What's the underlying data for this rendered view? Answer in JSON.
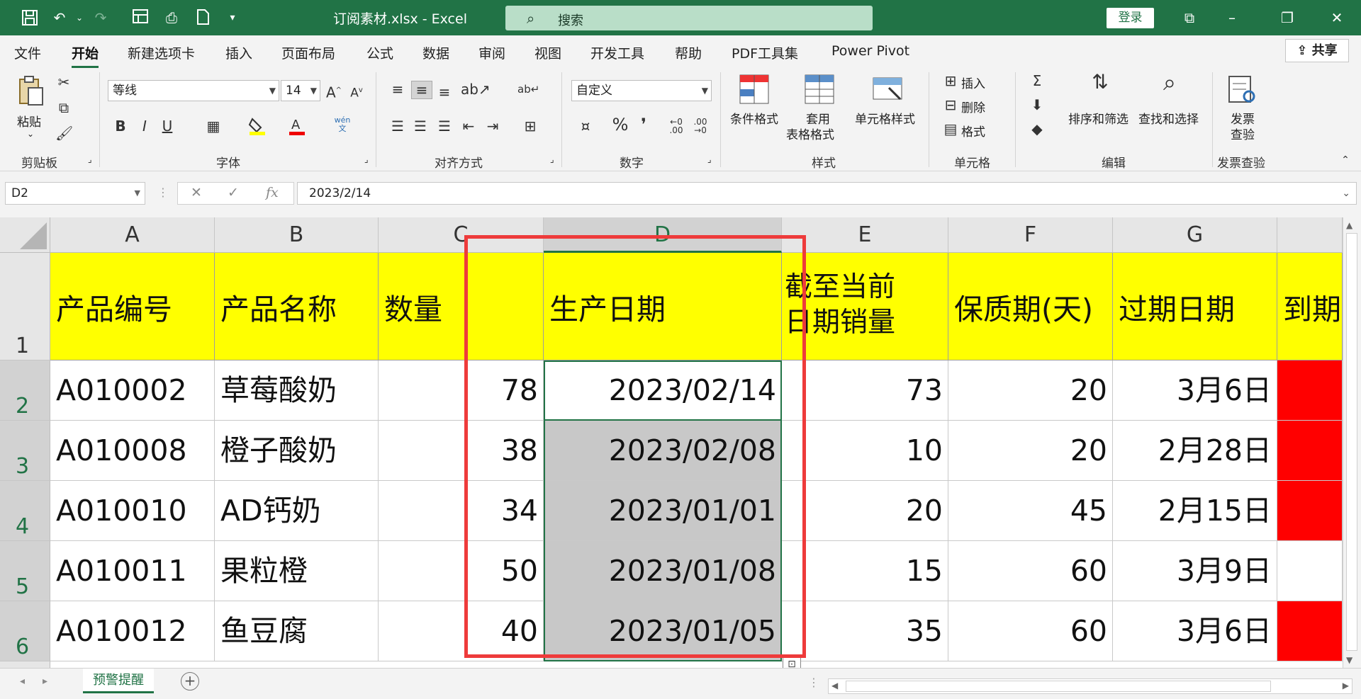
{
  "titlebar": {
    "doc_title": "订阅素材.xlsx  -  Excel",
    "search_placeholder": "搜索",
    "login": "登录",
    "icons": [
      "save-icon",
      "undo-icon",
      "redo-icon",
      "form-icon",
      "print-preview-icon",
      "file-icon",
      "customize-icon"
    ]
  },
  "tabs": [
    "文件",
    "开始",
    "新建选项卡",
    "插入",
    "页面布局",
    "公式",
    "数据",
    "审阅",
    "视图",
    "开发工具",
    "帮助",
    "PDF工具集",
    "Power Pivot"
  ],
  "active_tab": "开始",
  "share": "共享",
  "ribbon": {
    "clipboard": {
      "paste": "粘贴",
      "label": "剪贴板"
    },
    "font": {
      "name": "等线",
      "size": "14",
      "label": "字体",
      "bold": "B",
      "italic": "I",
      "underline": "U",
      "wen": "wén"
    },
    "alignment": {
      "label": "对齐方式"
    },
    "number": {
      "format": "自定义",
      "label": "数字",
      "percent": "%",
      "comma": "❜"
    },
    "styles": {
      "conditional": "条件格式",
      "table_line1": "套用",
      "table_line2": "表格格式",
      "cell_styles": "单元格样式",
      "label": "样式"
    },
    "cells": {
      "insert": "插入",
      "delete": "删除",
      "format": "格式",
      "label": "单元格"
    },
    "editing": {
      "sort_filter": "排序和筛选",
      "find_select": "查找和选择",
      "label": "编辑"
    },
    "invoice": {
      "line1": "发票",
      "line2": "查验",
      "label": "发票查验"
    }
  },
  "formula_bar": {
    "name_box": "D2",
    "formula": "2023/2/14"
  },
  "sheet": {
    "columns": [
      "A",
      "B",
      "C",
      "D",
      "E",
      "F",
      "G"
    ],
    "rows": [
      "1",
      "2",
      "3",
      "4",
      "5",
      "6"
    ],
    "headers": [
      "产品编号",
      "产品名称",
      "数量",
      "生产日期",
      "截至当前",
      "日期销量",
      "保质期(天)",
      "过期日期",
      "到期"
    ],
    "data": [
      [
        "A010002",
        "草莓酸奶",
        "78",
        "2023/02/14",
        "73",
        "20",
        "3月6日"
      ],
      [
        "A010008",
        "橙子酸奶",
        "38",
        "2023/02/08",
        "10",
        "20",
        "2月28日"
      ],
      [
        "A010010",
        "AD钙奶",
        "34",
        "2023/01/01",
        "20",
        "45",
        "2月15日"
      ],
      [
        "A010011",
        "果粒橙",
        "50",
        "2023/01/08",
        "15",
        "60",
        "3月9日"
      ],
      [
        "A010012",
        "鱼豆腐",
        "40",
        "2023/01/05",
        "35",
        "60",
        "3月6日"
      ]
    ]
  },
  "sheet_tab": "预警提醒",
  "colors": {
    "accent": "#217346",
    "header_fill": "#ffff00",
    "alert_fill": "#ff0000",
    "highlight_box": "#ee3b3b"
  }
}
